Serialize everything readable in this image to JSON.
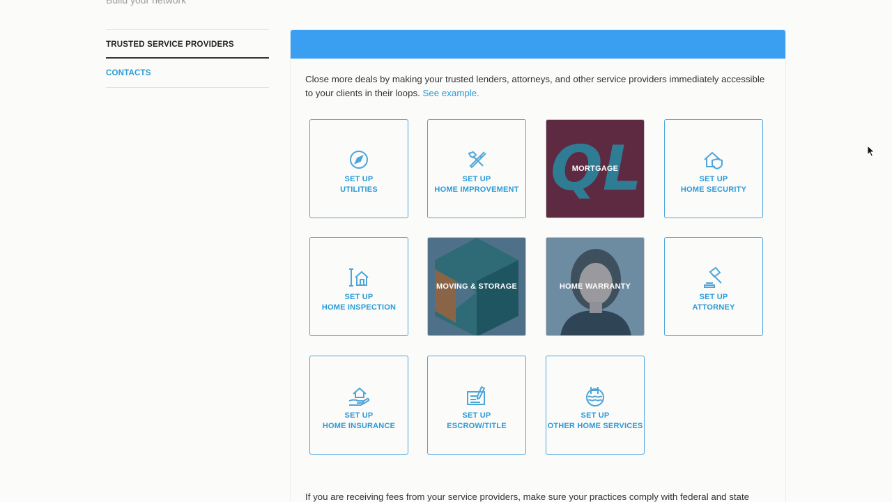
{
  "page": {
    "subheading": "Build your network"
  },
  "sidenav": {
    "items": [
      {
        "label": "TRUSTED SERVICE PROVIDERS",
        "active": true
      },
      {
        "label": "CONTACTS",
        "active": false
      }
    ]
  },
  "panel": {
    "intro_text": "Close more deals by making your trusted lenders, attorneys, and other service providers immediately accessible to your clients in their loops.",
    "intro_link": "See example.",
    "footer_text": "If you are receiving fees from your service providers, make sure your practices comply with federal and state"
  },
  "tiles": [
    {
      "line1": "SET UP",
      "line2": "UTILITIES",
      "icon": "compass-icon"
    },
    {
      "line1": "SET UP",
      "line2": "HOME IMPROVEMENT",
      "icon": "tools-icon"
    },
    {
      "line1": "",
      "line2": "MORTGAGE",
      "icon": "ql-logo",
      "logo_text": "QL",
      "bg_color": "#5e2a41",
      "logo_color": "#2f7d95"
    },
    {
      "line1": "SET UP",
      "line2": "HOME SECURITY",
      "icon": "house-shield-icon"
    },
    {
      "line1": "SET UP",
      "line2": "HOME INSPECTION",
      "icon": "house-measure-icon"
    },
    {
      "line1": "",
      "line2": "MOVING & STORAGE",
      "icon": "box-image",
      "bg_color": "#4e7189"
    },
    {
      "line1": "",
      "line2": "HOME WARRANTY",
      "icon": "person-photo",
      "bg_color": "#5a7890"
    },
    {
      "line1": "SET UP",
      "line2": "ATTORNEY",
      "icon": "gavel-icon"
    },
    {
      "line1": "SET UP",
      "line2": "HOME INSURANCE",
      "icon": "hand-house-icon"
    },
    {
      "line1": "SET UP",
      "line2": "ESCROW/TITLE",
      "icon": "document-pen-icon"
    },
    {
      "line1": "SET UP",
      "line2": "OTHER HOME SERVICES",
      "icon": "pool-icon"
    }
  ],
  "colors": {
    "accent": "#3a9ff0",
    "link": "#2a9ad6",
    "tile_border": "#4ea5da"
  }
}
